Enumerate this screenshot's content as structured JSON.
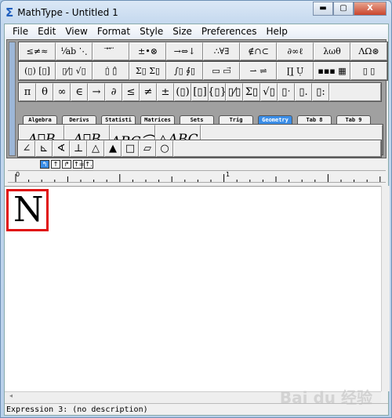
{
  "window": {
    "title": "MathType - Untitled 1",
    "minimize": "▬",
    "maximize": "▢",
    "close": "X"
  },
  "menu": [
    "File",
    "Edit",
    "View",
    "Format",
    "Style",
    "Size",
    "Preferences",
    "Help"
  ],
  "palette": {
    "row1": [
      "≤≠≈",
      "⅟ab ⋱",
      "⃗ ⃡ ⃛",
      "±•⊗",
      "→⇔↓",
      "∴∀∃",
      "∉∩⊂",
      "∂∞ℓ",
      "λωθ",
      "ΛΩ⊛"
    ],
    "row2": [
      "(▯) [▯]",
      "▯⁄▯ √▯",
      "▯̇ ▯̂",
      "Σ▯ Σ▯",
      "∫▯ ∮▯",
      "▭ ▭⃗",
      "⇀ ⇌",
      "∏̲ Ụ",
      "▪▪▪ ▦",
      "▯ ▯"
    ],
    "row3": [
      "π",
      "θ",
      "∞",
      "∈",
      "→",
      "∂",
      "≤",
      "≠",
      "±",
      "(▯)",
      "[▯]",
      "{▯}",
      "▯⁄▯",
      "Σ▯",
      "√▯",
      "▯ˑ",
      "▯.",
      "▯:"
    ],
    "tabs": [
      {
        "label": "Algebra",
        "active": false
      },
      {
        "label": "Derivs",
        "active": false
      },
      {
        "label": "Statisti",
        "active": false
      },
      {
        "label": "Matrices",
        "active": false
      },
      {
        "label": "Sets",
        "active": false
      },
      {
        "label": "Trig",
        "active": false
      },
      {
        "label": "Geometry",
        "active": true
      },
      {
        "label": "Tab 8",
        "active": false
      },
      {
        "label": "Tab 9",
        "active": false
      }
    ],
    "templates": [
      "A⃗B",
      "A⃡B",
      "ABC⌒",
      "△ABC"
    ],
    "shapes": [
      "∠",
      "⊾",
      "∢",
      "⊥",
      "△",
      "▲",
      "□",
      "▱",
      "○"
    ]
  },
  "alignment_buttons": [
    "↰",
    "↑",
    "↱",
    "↑=",
    "↑."
  ],
  "ruler": {
    "marks": [
      "0",
      "1"
    ]
  },
  "editor": {
    "expression": "N"
  },
  "status": "Expression 3: (no description)",
  "watermark": "Bai du 经验"
}
